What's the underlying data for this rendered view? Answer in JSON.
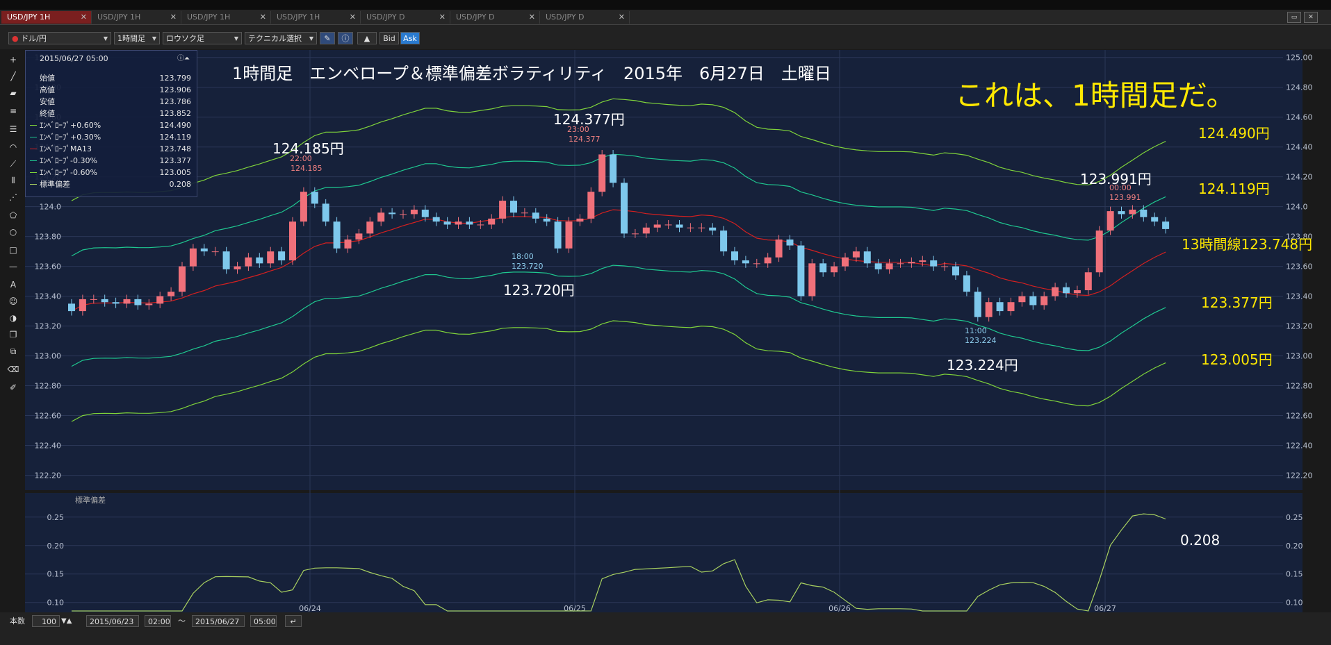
{
  "tabs": [
    {
      "label": "USD/JPY 1H",
      "active": true
    },
    {
      "label": "USD/JPY 1H",
      "active": false
    },
    {
      "label": "USD/JPY 1H",
      "active": false
    },
    {
      "label": "USD/JPY 1H",
      "active": false
    },
    {
      "label": "USD/JPY D",
      "active": false
    },
    {
      "label": "USD/JPY D",
      "active": false
    },
    {
      "label": "USD/JPY D",
      "active": false
    }
  ],
  "toolbar": {
    "symbol": "ドル/円",
    "timeframe": "1時間足",
    "chart_style": "ロウソク足",
    "technical": "テクニカル選択",
    "bid_label": "Bid",
    "ask_label": "Ask"
  },
  "info_panel": {
    "datetime": "2015/06/27 05:00",
    "rows": [
      {
        "label": "始値",
        "value": "123.799"
      },
      {
        "label": "高値",
        "value": "123.906"
      },
      {
        "label": "安値",
        "value": "123.786"
      },
      {
        "label": "終値",
        "value": "123.852"
      },
      {
        "label": "ｴﾝﾍﾞﾛｰﾌﾟ+0.60%",
        "value": "124.490",
        "color": "#7fd33a"
      },
      {
        "label": "ｴﾝﾍﾞﾛｰﾌﾟ+0.30%",
        "value": "124.119",
        "color": "#1fc890"
      },
      {
        "label": "ｴﾝﾍﾞﾛｰﾌﾟMA13",
        "value": "123.748",
        "color": "#d42020"
      },
      {
        "label": "ｴﾝﾍﾞﾛｰﾌﾟ-0.30%",
        "value": "123.377",
        "color": "#1fc890"
      },
      {
        "label": "ｴﾝﾍﾞﾛｰﾌﾟ-0.60%",
        "value": "123.005",
        "color": "#7fd33a"
      },
      {
        "label": "標準偏差",
        "value": "0.208",
        "color": "#a8d060"
      }
    ]
  },
  "annotations": {
    "title": "1時間足　エンベロープ＆標準偏差ボラティリティ　2015年　6月27日　土曜日",
    "headline": "これは、1時間足だ。",
    "peak1_price": "124.185円",
    "peak1_time": "22:00",
    "peak1_val": "124.185",
    "peak2_price": "124.377円",
    "peak2_time": "23:00",
    "peak2_val": "124.377",
    "low1_price": "123.720円",
    "low1_time": "18:00",
    "low1_val": "123.720",
    "low2_price": "123.224円",
    "low2_time": "11:00",
    "low2_val": "123.224",
    "peak3_price": "123.991円",
    "peak3_time": "00:00",
    "peak3_val": "123.991",
    "env_up2": "124.490円",
    "env_up1": "124.119円",
    "ma13": "13時間線123.748円",
    "env_dn1": "123.377円",
    "env_dn2": "123.005円",
    "stdev_now": "0.208",
    "sub_title": "標準偏差"
  },
  "bottom": {
    "count_label": "本数",
    "count_value": "100",
    "from_date": "2015/06/23",
    "from_time": "02:00",
    "tilde": "～",
    "to_date": "2015/06/27",
    "to_time": "05:00"
  },
  "colors": {
    "bg": "#16213a",
    "bull": "#f0707a",
    "bear": "#7ec8ec",
    "ma": "#d42020",
    "env1": "#1fc890",
    "env2": "#7fd33a",
    "stdev": "#a8d060",
    "accent_yellow": "#ffe800"
  },
  "chart_data": [
    {
      "type": "candlestick",
      "title": "",
      "x": [
        "06/24",
        "06/25",
        "06/26",
        "06/27"
      ],
      "y_ticks": [
        "125.00",
        "124.80",
        "124.60",
        "124.40",
        "124.20",
        "124.0",
        "123.80",
        "123.60",
        "123.40",
        "123.20",
        "123.00",
        "122.80",
        "122.60",
        "122.40",
        "122.20"
      ],
      "ylim": [
        122.1,
        125.05
      ],
      "closes": [
        123.3,
        123.38,
        123.38,
        123.36,
        123.35,
        123.38,
        123.34,
        123.35,
        123.4,
        123.43,
        123.6,
        123.72,
        123.7,
        123.7,
        123.58,
        123.6,
        123.66,
        123.62,
        123.7,
        123.64,
        123.9,
        124.1,
        124.02,
        123.9,
        123.72,
        123.78,
        123.82,
        123.9,
        123.96,
        123.95,
        123.95,
        123.98,
        123.93,
        123.9,
        123.88,
        123.9,
        123.88,
        123.88,
        123.92,
        124.04,
        123.96,
        123.96,
        123.92,
        123.9,
        123.72,
        123.9,
        123.92,
        124.1,
        124.35,
        124.16,
        123.82,
        123.82,
        123.86,
        123.88,
        123.88,
        123.86,
        123.86,
        123.86,
        123.84,
        123.7,
        123.64,
        123.62,
        123.62,
        123.66,
        123.78,
        123.74,
        123.4,
        123.62,
        123.56,
        123.6,
        123.66,
        123.7,
        123.62,
        123.58,
        123.62,
        123.62,
        123.63,
        123.64,
        123.6,
        123.6,
        123.54,
        123.43,
        123.26,
        123.36,
        123.3,
        123.36,
        123.4,
        123.34,
        123.4,
        123.46,
        123.42,
        123.44,
        123.56,
        123.84,
        123.97,
        123.95,
        123.98,
        123.93,
        123.9,
        123.85
      ],
      "series": [
        {
          "name": "ｴﾝﾍﾞﾛｰﾌﾟ+0.60%",
          "last": 124.49
        },
        {
          "name": "ｴﾝﾍﾞﾛｰﾌﾟ+0.30%",
          "last": 124.119
        },
        {
          "name": "ｴﾝﾍﾞﾛｰﾌﾟMA13",
          "last": 123.748
        },
        {
          "name": "ｴﾝﾍﾞﾛｰﾌﾟ-0.30%",
          "last": 123.377
        },
        {
          "name": "ｴﾝﾍﾞﾛｰﾌﾟ-0.60%",
          "last": 123.005
        }
      ]
    },
    {
      "type": "line",
      "title": "標準偏差",
      "y_ticks": [
        "0.25",
        "0.20",
        "0.15",
        "0.10"
      ],
      "ylim": [
        0.085,
        0.29
      ],
      "series": [
        {
          "name": "標準偏差",
          "last": 0.208
        }
      ]
    }
  ]
}
